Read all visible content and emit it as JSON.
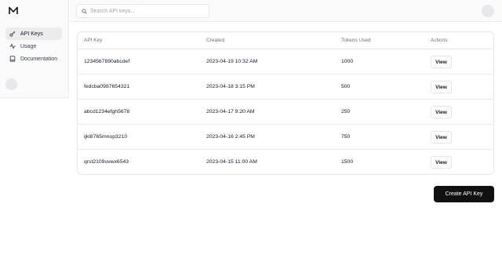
{
  "sidebar": {
    "logo_icon": "mountain-logo-icon",
    "items": [
      {
        "label": "API Keys",
        "icon": "key-icon",
        "active": true
      },
      {
        "label": "Usage",
        "icon": "activity-icon",
        "active": false
      },
      {
        "label": "Documentation",
        "icon": "book-icon",
        "active": false
      }
    ]
  },
  "search": {
    "placeholder": "Search API keys...",
    "value": ""
  },
  "table": {
    "headers": [
      "API Key",
      "Created",
      "Tokens Used",
      "Actions"
    ],
    "rows": [
      {
        "key": "1234567890abcdef",
        "created": "2023-04-19 10:32 AM",
        "tokens": "1000",
        "action": "View"
      },
      {
        "key": "fedcba0987654321",
        "created": "2023-04-18 3:15 PM",
        "tokens": "500",
        "action": "View"
      },
      {
        "key": "abcd1234efgh5678",
        "created": "2023-04-17 9:20 AM",
        "tokens": "250",
        "action": "View"
      },
      {
        "key": "ijkl8765mnop3210",
        "created": "2023-04-16 2:45 PM",
        "tokens": "750",
        "action": "View"
      },
      {
        "key": "qrst2109uvwx6543",
        "created": "2023-04-15 11:00 AM",
        "tokens": "1500",
        "action": "View"
      }
    ]
  },
  "create_button": {
    "label": "Create API Key"
  },
  "colors": {
    "primary_button": "#111111",
    "sidebar_bg": "#fafafa",
    "active_item_bg": "#ececec",
    "border": "#e5e7eb"
  }
}
